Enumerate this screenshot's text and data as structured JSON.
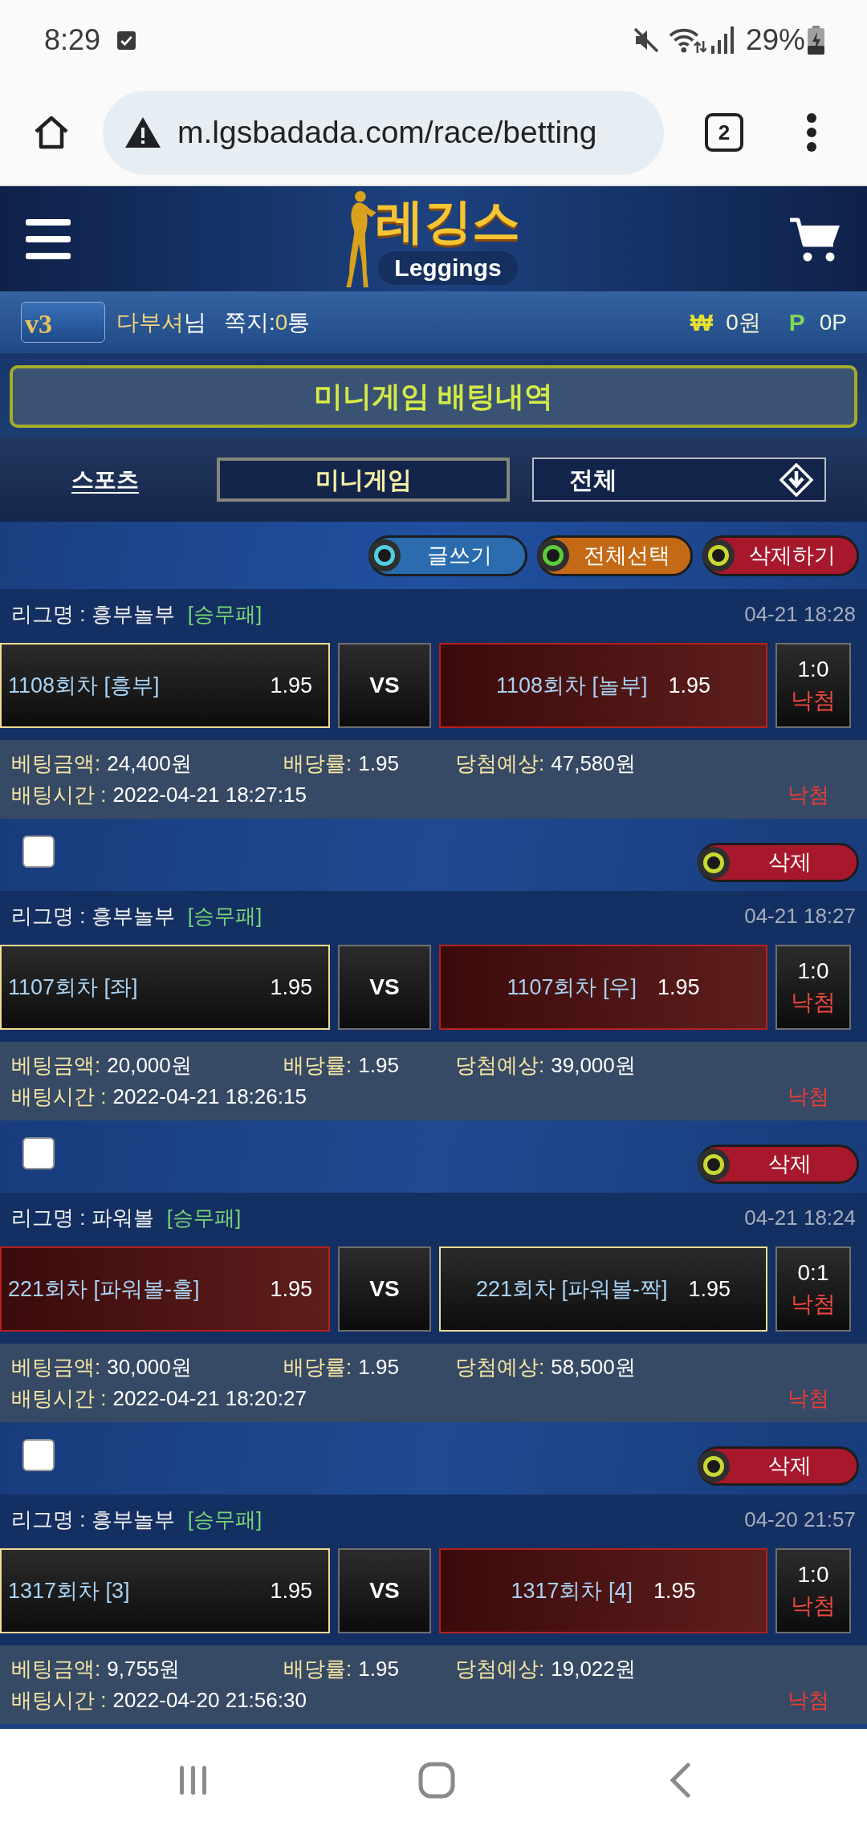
{
  "status_bar": {
    "time": "8:29",
    "battery": "29%"
  },
  "browser": {
    "url": "m.lgsbadada.com/race/betting",
    "tab_count": "2"
  },
  "header": {
    "logo_title": "레깅스",
    "logo_subtitle": "Leggings"
  },
  "user_bar": {
    "level": "v3",
    "nickname": "다부셔",
    "honorific": "님",
    "messages_label": "쪽지:",
    "messages_count": "0",
    "messages_unit": "통",
    "money_symbol": "₩",
    "money": "0원",
    "point_symbol": "P",
    "points": "0P"
  },
  "page_title": "미니게임 배팅내역",
  "tabs": [
    {
      "label": "스포츠",
      "selected": false
    },
    {
      "label": "미니게임",
      "selected": true
    }
  ],
  "filter": {
    "value": "전체"
  },
  "actions": [
    {
      "label": "글쓰기",
      "color": "#2a6cae",
      "dot": {
        "color": "#4fd0e0"
      }
    },
    {
      "label": "전체선택",
      "color": "#c46a16",
      "dot": {
        "color": "#5ccc3a"
      }
    },
    {
      "label": "삭제하기",
      "color": "#a8182c",
      "dot": {
        "color": "#c8d830"
      }
    }
  ],
  "bets": [
    {
      "league": "리그명 : 흥부놀부",
      "market": "[승무패]",
      "time": "04-21 18:28",
      "home": {
        "label": "1108회차 [흥부]",
        "odds": "1.95",
        "selected": true
      },
      "vs": "VS",
      "away": {
        "label": "1108회차 [놀부]",
        "odds": "1.95",
        "selected": false
      },
      "score": "1:0",
      "result": "낙첨",
      "details": [
        {
          "label": "베팅금액:",
          "value": "24,400원"
        },
        {
          "label": "배당률:",
          "value": "1.95"
        },
        {
          "label": "당첨예상:",
          "value": "47,580원"
        },
        {
          "label": "배팅시간 :",
          "value": "2022-04-21 18:27:15"
        }
      ],
      "status": "낙첨",
      "checked": false,
      "delete": "삭제"
    },
    {
      "league": "리그명 : 흥부놀부",
      "market": "[승무패]",
      "time": "04-21 18:27",
      "home": {
        "label": "1107회차 [좌]",
        "odds": "1.95",
        "selected": true
      },
      "vs": "VS",
      "away": {
        "label": "1107회차 [우]",
        "odds": "1.95",
        "selected": false
      },
      "score": "1:0",
      "result": "낙첨",
      "details": [
        {
          "label": "베팅금액:",
          "value": "20,000원"
        },
        {
          "label": "배당률:",
          "value": "1.95"
        },
        {
          "label": "당첨예상:",
          "value": "39,000원"
        },
        {
          "label": "배팅시간 :",
          "value": "2022-04-21 18:26:15"
        }
      ],
      "status": "낙첨",
      "checked": false,
      "delete": "삭제"
    },
    {
      "league": "리그명 : 파워볼",
      "market": "[승무패]",
      "time": "04-21 18:24",
      "home": {
        "label": "221회차 [파워볼-홀]",
        "odds": "1.95",
        "selected": false
      },
      "vs": "VS",
      "away": {
        "label": "221회차 [파워볼-짝]",
        "odds": "1.95",
        "selected": true
      },
      "score": "0:1",
      "result": "낙첨",
      "details": [
        {
          "label": "베팅금액:",
          "value": "30,000원"
        },
        {
          "label": "배당률:",
          "value": "1.95"
        },
        {
          "label": "당첨예상:",
          "value": "58,500원"
        },
        {
          "label": "배팅시간 :",
          "value": "2022-04-21 18:20:27"
        }
      ],
      "status": "낙첨",
      "checked": false,
      "delete": "삭제"
    },
    {
      "league": "리그명 : 흥부놀부",
      "market": "[승무패]",
      "time": "04-20 21:57",
      "home": {
        "label": "1317회차 [3]",
        "odds": "1.95",
        "selected": true
      },
      "vs": "VS",
      "away": {
        "label": "1317회차 [4]",
        "odds": "1.95",
        "selected": false
      },
      "score": "1:0",
      "result": "낙첨",
      "details": [
        {
          "label": "베팅금액:",
          "value": "9,755원"
        },
        {
          "label": "배당률:",
          "value": "1.95"
        },
        {
          "label": "당첨예상:",
          "value": "19,022원"
        },
        {
          "label": "배팅시간 :",
          "value": "2022-04-20 21:56:30"
        }
      ],
      "status": "낙첨"
    }
  ]
}
